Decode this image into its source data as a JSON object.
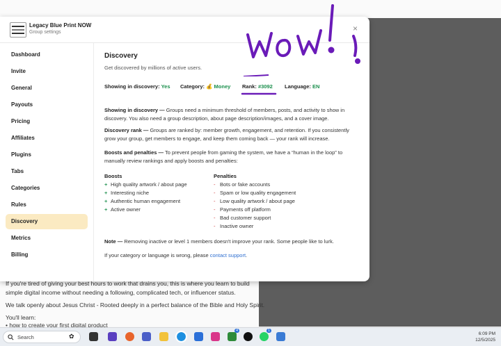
{
  "background": {
    "line1": "If you're tired of giving your best hours to work that drains you, this is where you learn to build",
    "line2": "simple digital income without needing a following, complicated tech, or influencer status.",
    "line3": "We talk openly about Jesus Christ - Rooted deeply in a perfect balance of the Bible and Holy Spirit.",
    "line4": "You'll learn:",
    "line5": "how to create your first digital product"
  },
  "header": {
    "group_name": "Legacy Blue Print NOW",
    "subtitle": "Group settings",
    "close_symbol": "×"
  },
  "sidebar": {
    "items": [
      {
        "label": "Dashboard"
      },
      {
        "label": "Invite"
      },
      {
        "label": "General"
      },
      {
        "label": "Payouts"
      },
      {
        "label": "Pricing"
      },
      {
        "label": "Affiliates"
      },
      {
        "label": "Plugins"
      },
      {
        "label": "Tabs"
      },
      {
        "label": "Categories"
      },
      {
        "label": "Rules"
      },
      {
        "label": "Discovery"
      },
      {
        "label": "Metrics"
      },
      {
        "label": "Billing"
      }
    ],
    "active": "Discovery"
  },
  "discovery": {
    "title": "Discovery",
    "subtitle": "Get discovered by millions of active users.",
    "showing_label": "Showing in discovery:",
    "showing_value": "Yes",
    "category_label": "Category:",
    "category_emoji": "💰",
    "category_value": "Money",
    "rank_label": "Rank:",
    "rank_value": "#3092",
    "language_label": "Language:",
    "language_value": "EN",
    "p1_head": "Showing in discovery —",
    "p1_body": " Groups need a minimum threshold of members, posts, and activity to show in discovery. You also need a group description, about page description/images, and a cover image.",
    "p2_head": "Discovery rank —",
    "p2_body": " Groups are ranked by: member growth, engagement, and retention. If you consistently grow your group, get members to engage, and keep them coming back — your rank will increase.",
    "p3_head": "Boosts and penalties —",
    "p3_body": " To prevent people from gaming the system, we have a “human in the loop” to manually review rankings and apply boosts and penalties:",
    "boosts_title": "Boosts",
    "boosts": [
      "High quality artwork / about page",
      "Interesting niche",
      "Authentic human engagement",
      "Active owner"
    ],
    "penalties_title": "Penalties",
    "penalties": [
      "Bots or fake accounts",
      "Spam or low quality engagement",
      "Low quality artwork / about page",
      "Payments off platform",
      "Bad customer support",
      "Inactive owner"
    ],
    "note_head": "Note —",
    "note_body": " Removing inactive or level 1 members doesn't improve your rank. Some people like to lurk.",
    "wrong_text": "If your category or language is wrong, please ",
    "contact_link": "contact support",
    "wrong_end": "."
  },
  "annotation": {
    "handwritten_text": "Wow!",
    "color": "#6a1bb8"
  },
  "taskbar": {
    "search_label": "Search",
    "time": "6:09 PM",
    "date": "12/5/2025",
    "badge1": "4",
    "badge2": "1"
  },
  "colors": {
    "active_nav": "#fbeac2",
    "green": "#1a8f4c",
    "link": "#2f6fd0",
    "overlay": "#5d5d5d"
  }
}
